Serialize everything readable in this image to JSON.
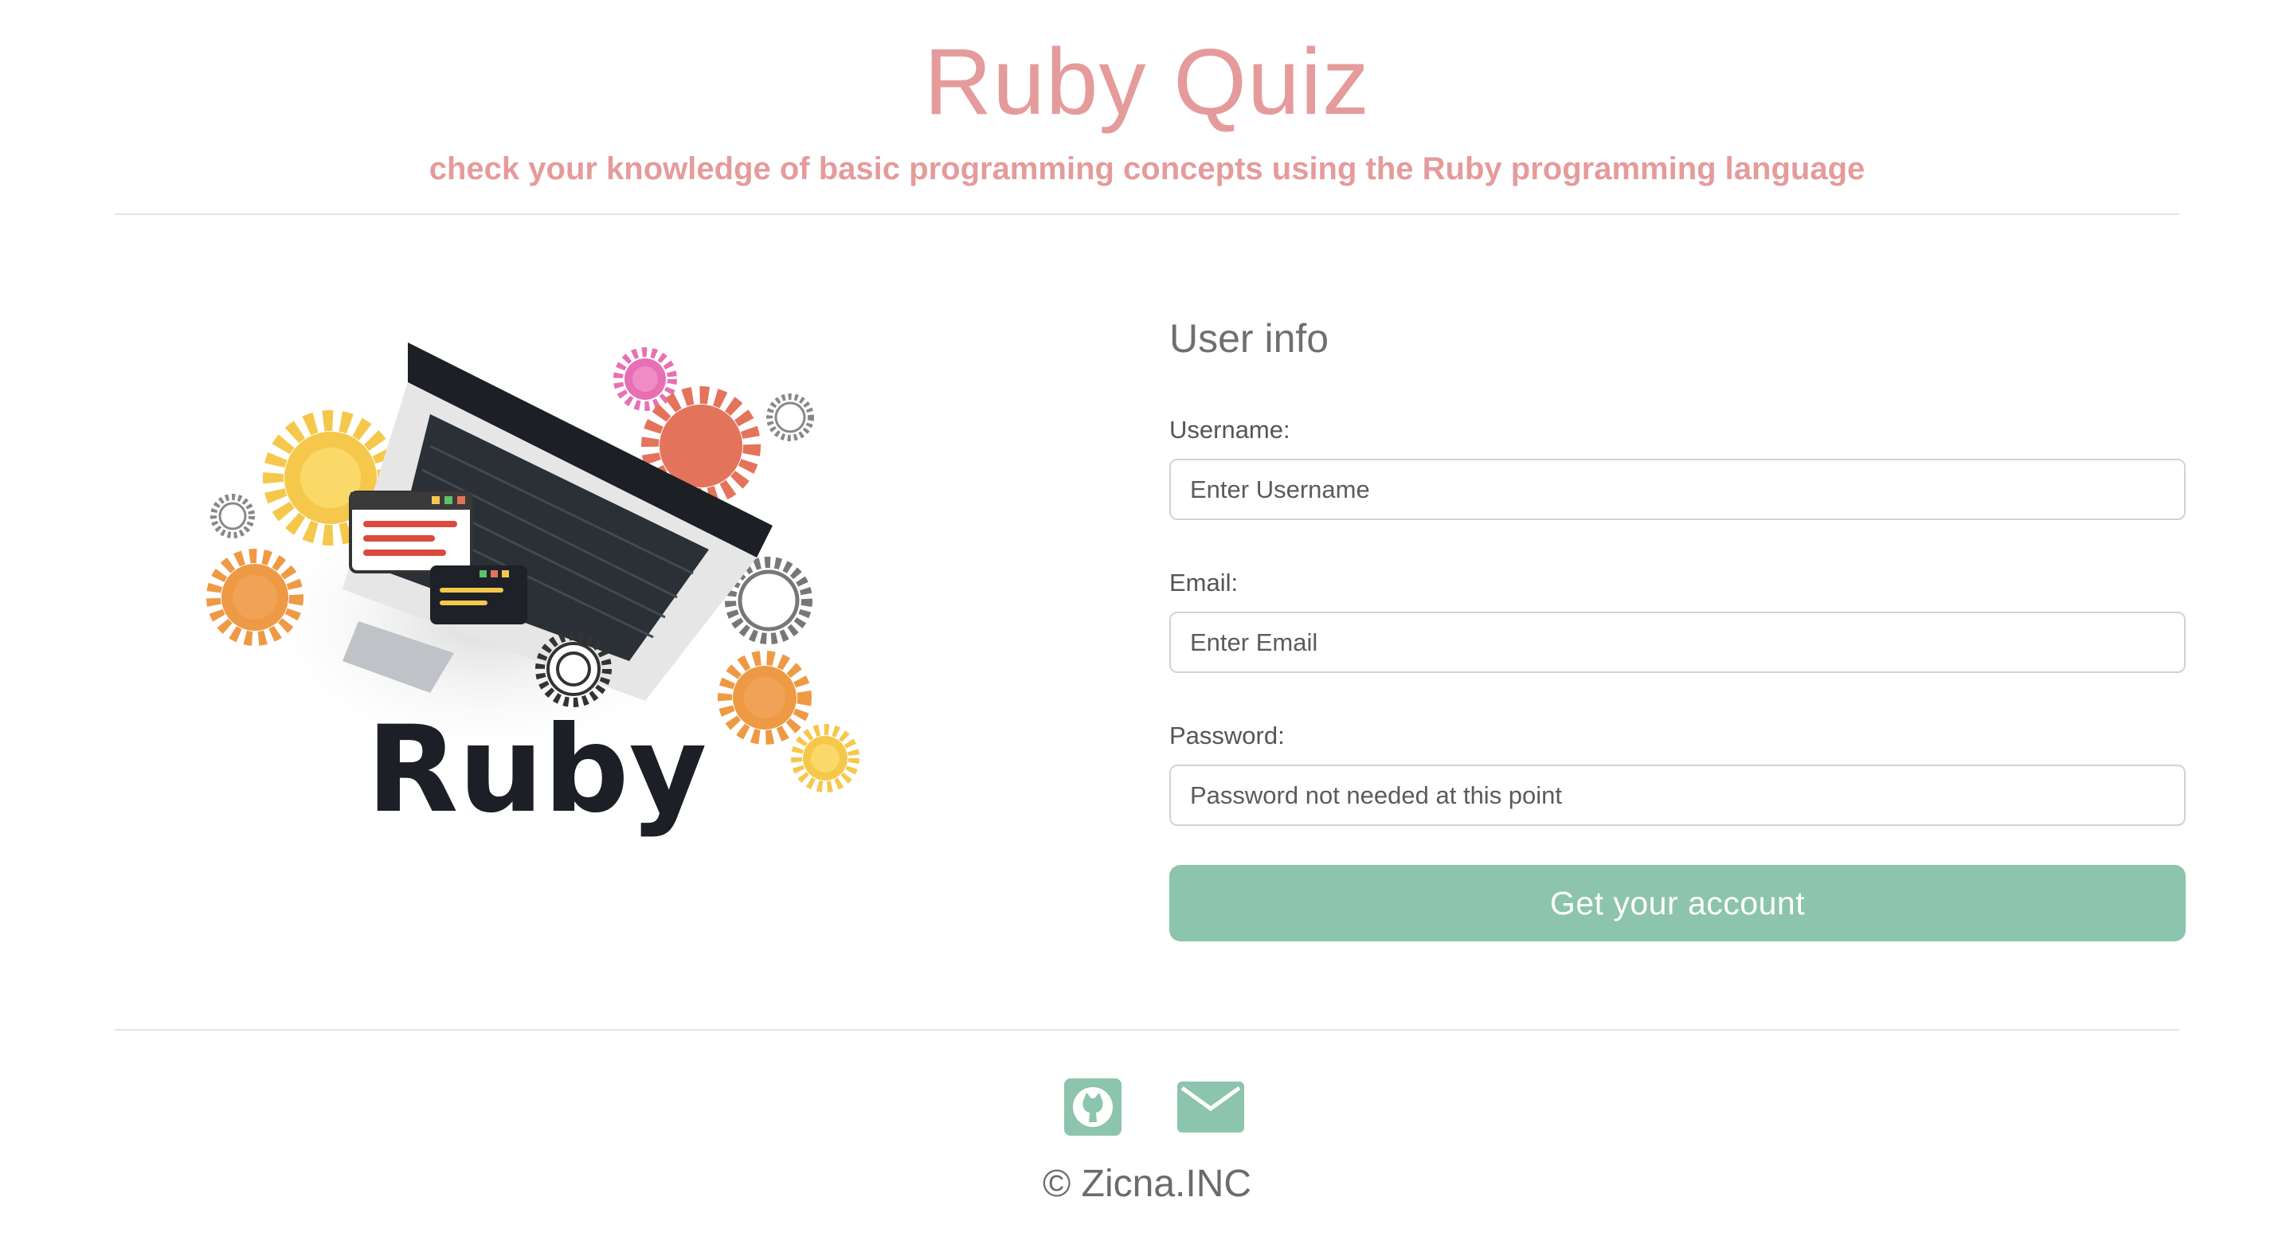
{
  "header": {
    "title": "Ruby Quiz",
    "subtitle": "check your knowledge of basic programming concepts using the Ruby programming language"
  },
  "hero": {
    "logo_text": "Ruby",
    "image_name": "ruby-laptop-gears-illustration"
  },
  "form": {
    "title": "User info",
    "username": {
      "label": "Username:",
      "placeholder": "Enter Username",
      "value": ""
    },
    "email": {
      "label": "Email:",
      "placeholder": "Enter Email",
      "value": ""
    },
    "password": {
      "label": "Password:",
      "placeholder": "Password not needed at this point",
      "value": ""
    },
    "submit_label": "Get your account"
  },
  "footer": {
    "icons": [
      "github-icon",
      "mail-icon"
    ],
    "copyright": "© Zicna.INC"
  },
  "colors": {
    "accent_pink": "#e59b9b",
    "accent_green": "#8cc4ae",
    "text_gray": "#6f6f6f"
  }
}
